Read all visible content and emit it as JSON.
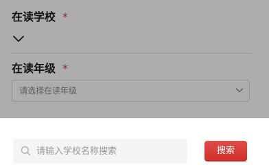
{
  "form": {
    "school_field": {
      "label": "在读学校",
      "required_mark": "*"
    },
    "grade_field": {
      "label": "在读年级",
      "required_mark": "*",
      "placeholder": "请选择在读年级"
    }
  },
  "search_sheet": {
    "input_placeholder": "请输入学校名称搜索",
    "input_value": "",
    "button_label": "搜索"
  },
  "icons": {
    "school_dropdown": "chevron-down-icon",
    "grade_dropdown": "chevron-down-icon",
    "search": "search-icon"
  },
  "colors": {
    "required": "#d93a3a",
    "button": "#d9393a",
    "overlay": "rgba(0,0,0,0.32)"
  }
}
